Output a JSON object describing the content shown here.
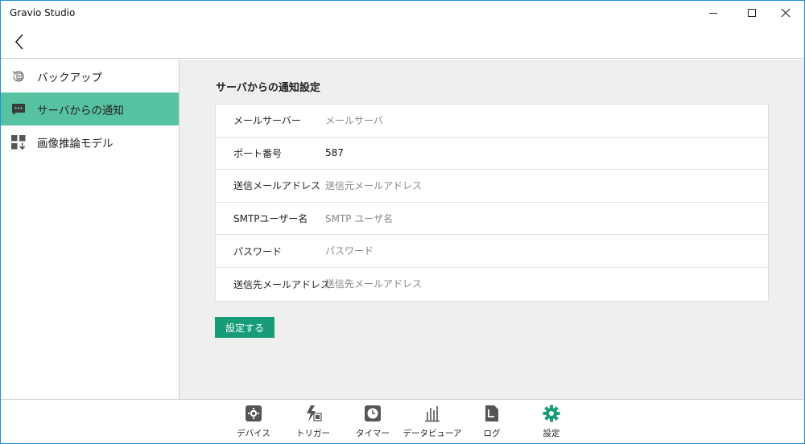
{
  "window": {
    "title": "Gravio Studio"
  },
  "sidebar": {
    "items": [
      {
        "label": "バックアップ",
        "icon": "backup-icon",
        "active": false
      },
      {
        "label": "サーバからの通知",
        "icon": "chat-icon",
        "active": true
      },
      {
        "label": "画像推論モデル",
        "icon": "model-download-icon",
        "active": false
      }
    ]
  },
  "main": {
    "section_title": "サーバからの通知設定",
    "fields": [
      {
        "label": "メールサーバー",
        "value": "",
        "placeholder": "メールサーバ"
      },
      {
        "label": "ポート番号",
        "value": "587",
        "placeholder": ""
      },
      {
        "label": "送信メールアドレス",
        "value": "",
        "placeholder": "送信元メールアドレス"
      },
      {
        "label": "SMTPユーザー名",
        "value": "",
        "placeholder": "SMTP ユーザ名"
      },
      {
        "label": "パスワード",
        "value": "",
        "placeholder": "パスワード"
      },
      {
        "label": "送信先メールアドレス",
        "value": "",
        "placeholder": "送信先メールアドレス"
      }
    ],
    "submit_label": "設定する"
  },
  "bottom_nav": {
    "items": [
      {
        "label": "デバイス",
        "icon": "device-icon",
        "active": false
      },
      {
        "label": "トリガー",
        "icon": "trigger-icon",
        "active": false
      },
      {
        "label": "タイマー",
        "icon": "timer-icon",
        "active": false
      },
      {
        "label": "データビューア",
        "icon": "data-viewer-icon",
        "active": false
      },
      {
        "label": "ログ",
        "icon": "log-icon",
        "active": false
      },
      {
        "label": "設定",
        "icon": "settings-icon",
        "active": true
      }
    ]
  },
  "colors": {
    "accent": "#179c78",
    "sidebar_active": "#57c2a1",
    "icon_gray": "#555555",
    "window_border": "#1f8fd6"
  }
}
